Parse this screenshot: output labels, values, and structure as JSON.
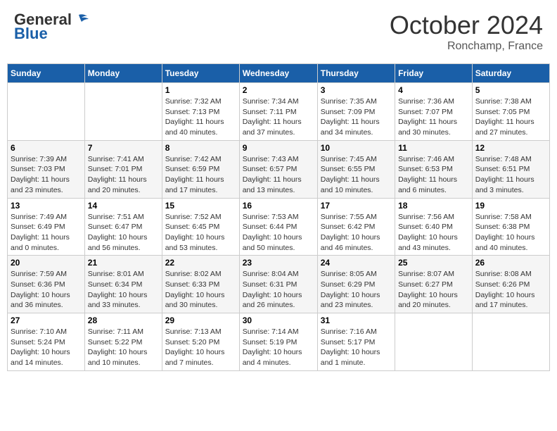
{
  "header": {
    "logo_line1": "General",
    "logo_line2": "Blue",
    "month": "October 2024",
    "location": "Ronchamp, France"
  },
  "days_of_week": [
    "Sunday",
    "Monday",
    "Tuesday",
    "Wednesday",
    "Thursday",
    "Friday",
    "Saturday"
  ],
  "weeks": [
    [
      {
        "day": "",
        "content": ""
      },
      {
        "day": "",
        "content": ""
      },
      {
        "day": "1",
        "content": "Sunrise: 7:32 AM\nSunset: 7:13 PM\nDaylight: 11 hours\nand 40 minutes."
      },
      {
        "day": "2",
        "content": "Sunrise: 7:34 AM\nSunset: 7:11 PM\nDaylight: 11 hours\nand 37 minutes."
      },
      {
        "day": "3",
        "content": "Sunrise: 7:35 AM\nSunset: 7:09 PM\nDaylight: 11 hours\nand 34 minutes."
      },
      {
        "day": "4",
        "content": "Sunrise: 7:36 AM\nSunset: 7:07 PM\nDaylight: 11 hours\nand 30 minutes."
      },
      {
        "day": "5",
        "content": "Sunrise: 7:38 AM\nSunset: 7:05 PM\nDaylight: 11 hours\nand 27 minutes."
      }
    ],
    [
      {
        "day": "6",
        "content": "Sunrise: 7:39 AM\nSunset: 7:03 PM\nDaylight: 11 hours\nand 23 minutes."
      },
      {
        "day": "7",
        "content": "Sunrise: 7:41 AM\nSunset: 7:01 PM\nDaylight: 11 hours\nand 20 minutes."
      },
      {
        "day": "8",
        "content": "Sunrise: 7:42 AM\nSunset: 6:59 PM\nDaylight: 11 hours\nand 17 minutes."
      },
      {
        "day": "9",
        "content": "Sunrise: 7:43 AM\nSunset: 6:57 PM\nDaylight: 11 hours\nand 13 minutes."
      },
      {
        "day": "10",
        "content": "Sunrise: 7:45 AM\nSunset: 6:55 PM\nDaylight: 11 hours\nand 10 minutes."
      },
      {
        "day": "11",
        "content": "Sunrise: 7:46 AM\nSunset: 6:53 PM\nDaylight: 11 hours\nand 6 minutes."
      },
      {
        "day": "12",
        "content": "Sunrise: 7:48 AM\nSunset: 6:51 PM\nDaylight: 11 hours\nand 3 minutes."
      }
    ],
    [
      {
        "day": "13",
        "content": "Sunrise: 7:49 AM\nSunset: 6:49 PM\nDaylight: 11 hours\nand 0 minutes."
      },
      {
        "day": "14",
        "content": "Sunrise: 7:51 AM\nSunset: 6:47 PM\nDaylight: 10 hours\nand 56 minutes."
      },
      {
        "day": "15",
        "content": "Sunrise: 7:52 AM\nSunset: 6:45 PM\nDaylight: 10 hours\nand 53 minutes."
      },
      {
        "day": "16",
        "content": "Sunrise: 7:53 AM\nSunset: 6:44 PM\nDaylight: 10 hours\nand 50 minutes."
      },
      {
        "day": "17",
        "content": "Sunrise: 7:55 AM\nSunset: 6:42 PM\nDaylight: 10 hours\nand 46 minutes."
      },
      {
        "day": "18",
        "content": "Sunrise: 7:56 AM\nSunset: 6:40 PM\nDaylight: 10 hours\nand 43 minutes."
      },
      {
        "day": "19",
        "content": "Sunrise: 7:58 AM\nSunset: 6:38 PM\nDaylight: 10 hours\nand 40 minutes."
      }
    ],
    [
      {
        "day": "20",
        "content": "Sunrise: 7:59 AM\nSunset: 6:36 PM\nDaylight: 10 hours\nand 36 minutes."
      },
      {
        "day": "21",
        "content": "Sunrise: 8:01 AM\nSunset: 6:34 PM\nDaylight: 10 hours\nand 33 minutes."
      },
      {
        "day": "22",
        "content": "Sunrise: 8:02 AM\nSunset: 6:33 PM\nDaylight: 10 hours\nand 30 minutes."
      },
      {
        "day": "23",
        "content": "Sunrise: 8:04 AM\nSunset: 6:31 PM\nDaylight: 10 hours\nand 26 minutes."
      },
      {
        "day": "24",
        "content": "Sunrise: 8:05 AM\nSunset: 6:29 PM\nDaylight: 10 hours\nand 23 minutes."
      },
      {
        "day": "25",
        "content": "Sunrise: 8:07 AM\nSunset: 6:27 PM\nDaylight: 10 hours\nand 20 minutes."
      },
      {
        "day": "26",
        "content": "Sunrise: 8:08 AM\nSunset: 6:26 PM\nDaylight: 10 hours\nand 17 minutes."
      }
    ],
    [
      {
        "day": "27",
        "content": "Sunrise: 7:10 AM\nSunset: 5:24 PM\nDaylight: 10 hours\nand 14 minutes."
      },
      {
        "day": "28",
        "content": "Sunrise: 7:11 AM\nSunset: 5:22 PM\nDaylight: 10 hours\nand 10 minutes."
      },
      {
        "day": "29",
        "content": "Sunrise: 7:13 AM\nSunset: 5:20 PM\nDaylight: 10 hours\nand 7 minutes."
      },
      {
        "day": "30",
        "content": "Sunrise: 7:14 AM\nSunset: 5:19 PM\nDaylight: 10 hours\nand 4 minutes."
      },
      {
        "day": "31",
        "content": "Sunrise: 7:16 AM\nSunset: 5:17 PM\nDaylight: 10 hours\nand 1 minute."
      },
      {
        "day": "",
        "content": ""
      },
      {
        "day": "",
        "content": ""
      }
    ]
  ]
}
